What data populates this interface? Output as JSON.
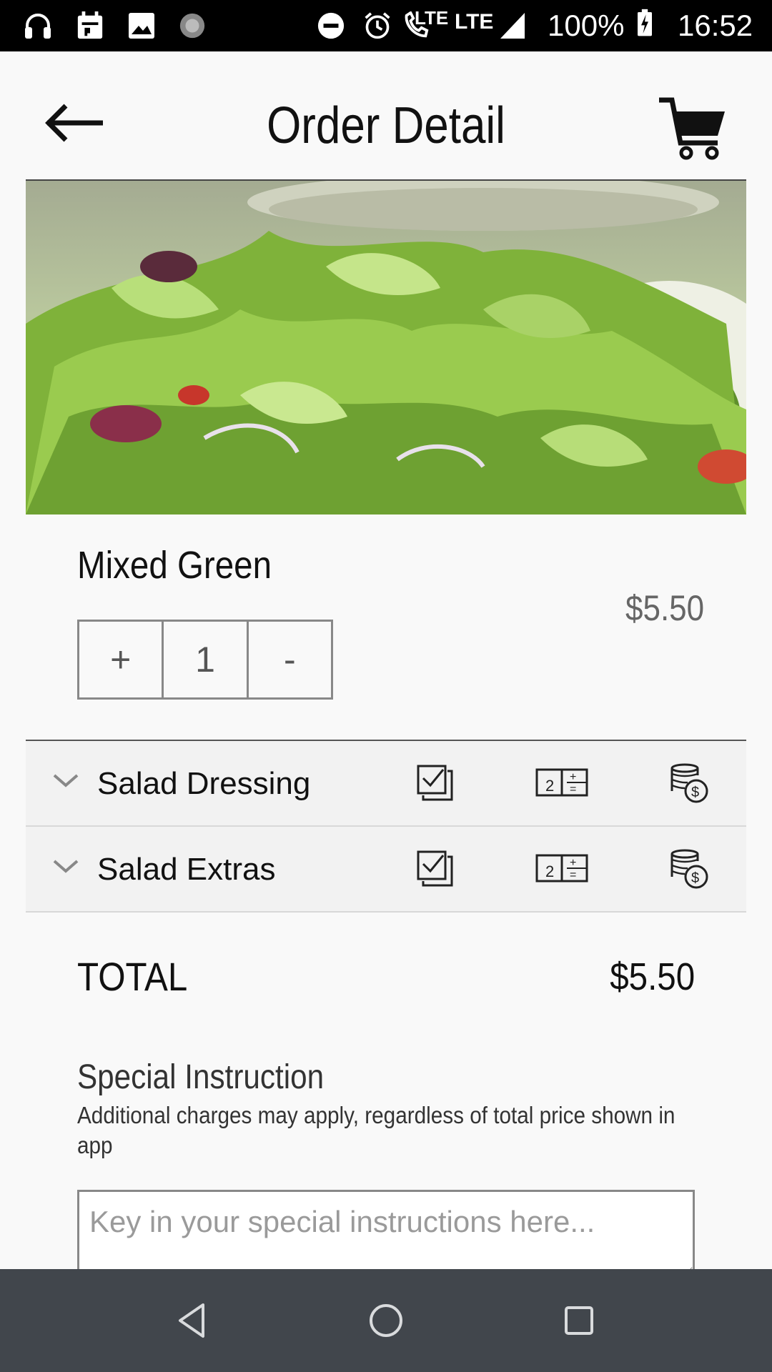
{
  "status_bar": {
    "lte_1": "LTE",
    "lte_2": "LTE",
    "battery": "100%",
    "time": "16:52",
    "icons": [
      "headset-icon",
      "calendar-icon",
      "image-icon",
      "loading-icon",
      "dnd-icon",
      "alarm-icon",
      "wifi-call-icon",
      "signal-icon",
      "battery-charging-icon"
    ]
  },
  "header": {
    "title": "Order Detail",
    "back_icon": "arrow-left-icon",
    "cart_icon": "cart-icon"
  },
  "item": {
    "name": "Mixed Green",
    "price": "$5.50",
    "quantity": "1",
    "plus_label": "+",
    "minus_label": "-"
  },
  "options": [
    {
      "label": "Salad Dressing",
      "icons": [
        "chevron-down-icon",
        "checkbox-stack-icon",
        "calculator-icon",
        "coins-icon"
      ]
    },
    {
      "label": "Salad Extras",
      "icons": [
        "chevron-down-icon",
        "checkbox-stack-icon",
        "calculator-icon",
        "coins-icon"
      ]
    }
  ],
  "total": {
    "label": "TOTAL",
    "value": "$5.50"
  },
  "special_instruction": {
    "title": "Special Instruction",
    "note": "Additional charges may apply, regardless of total price shown in app",
    "placeholder": "Key in your special instructions here..."
  },
  "colors": {
    "status_bar": "#000000",
    "background": "#f9f9f9",
    "option_row_bg": "#f2f2f2",
    "nav_bar": "#41464c"
  }
}
